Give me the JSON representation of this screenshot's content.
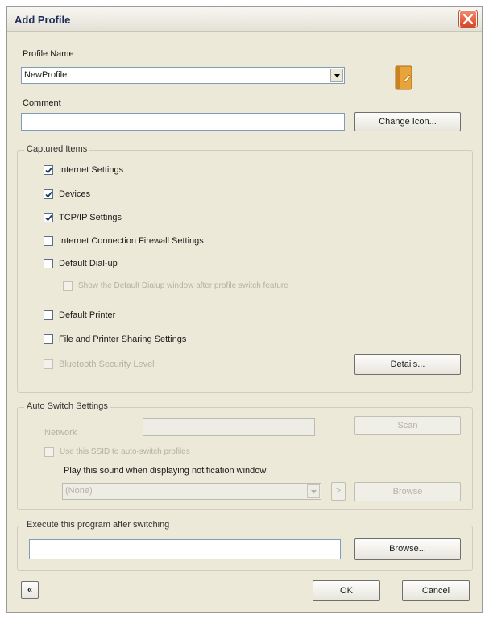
{
  "window": {
    "title": "Add Profile"
  },
  "profile_name": {
    "label": "Profile Name",
    "value": "NewProfile"
  },
  "comment": {
    "label": "Comment",
    "value": ""
  },
  "change_icon_label": "Change Icon...",
  "captured_items": {
    "title": "Captured Items",
    "items": [
      {
        "label": "Internet Settings",
        "checked": true,
        "enabled": true
      },
      {
        "label": "Devices",
        "checked": true,
        "enabled": true
      },
      {
        "label": "TCP/IP Settings",
        "checked": true,
        "enabled": true
      },
      {
        "label": "Internet Connection Firewall Settings",
        "checked": false,
        "enabled": true
      },
      {
        "label": "Default Dial-up",
        "checked": false,
        "enabled": true
      },
      {
        "label": "Show the Default Dialup window after profile switch feature",
        "checked": false,
        "enabled": false
      },
      {
        "label": "Default Printer",
        "checked": false,
        "enabled": true
      },
      {
        "label": "File and Printer Sharing Settings",
        "checked": false,
        "enabled": true
      },
      {
        "label": "Bluetooth Security Level",
        "checked": false,
        "enabled": false
      }
    ],
    "details_label": "Details..."
  },
  "auto_switch": {
    "title": "Auto Switch Settings",
    "network_label": "Network",
    "network_value": "",
    "scan_label": "Scan",
    "use_ssid_label": "Use this SSID to auto-switch profiles",
    "sound_label": "Play this sound when displaying notification window",
    "sound_value": "(None)",
    "play_label": ">",
    "browse_label": "Browse"
  },
  "execute": {
    "title": "Execute this program after switching",
    "value": "",
    "browse_label": "Browse..."
  },
  "footer": {
    "collapse_label": "«",
    "ok_label": "OK",
    "cancel_label": "Cancel"
  },
  "icons": {
    "profile_icon": "folder-icon",
    "close": "close-icon",
    "dropdown": "chevron-down-icon",
    "check": "check-icon"
  },
  "colors": {
    "title_text": "#1c2a5a",
    "close_button": "#d9452a",
    "dialog_bg": "#ece9d8",
    "field_border": "#7f9db9"
  }
}
